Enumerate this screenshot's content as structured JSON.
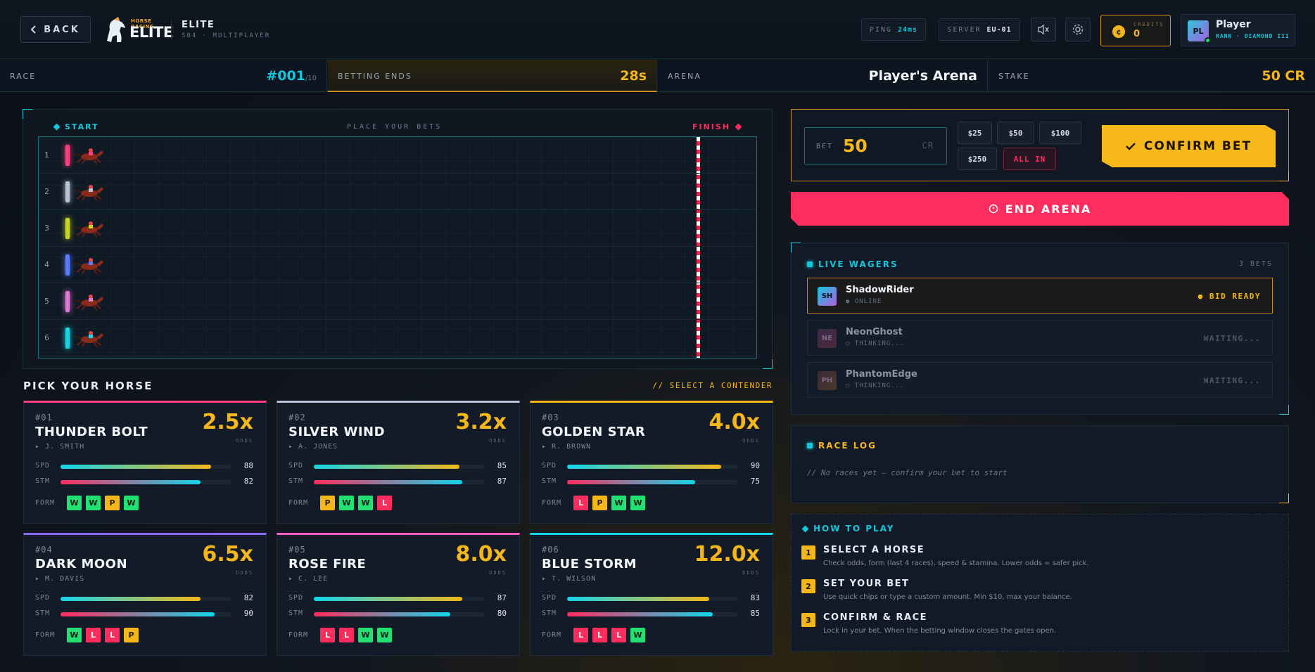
{
  "header": {
    "back_label": "BACK",
    "logo_small": "HORSE RACING",
    "logo_big": "ELITE",
    "title": "ELITE",
    "subtitle": "S04 · MULTIPLAYER",
    "ping_label": "PING",
    "ping_value": "24ms",
    "server_label": "SERVER",
    "server_value": "EU-01",
    "credits_label": "CREDITS",
    "credits_value": "0",
    "player_initials": "PL",
    "player_name": "Player",
    "player_rank": "RANK · DIAMOND III"
  },
  "strip": {
    "race_label": "RACE",
    "race_value": "#001",
    "race_total": "/10",
    "betting_label": "BETTING ENDS",
    "betting_value": "28s",
    "arena_label": "ARENA",
    "arena_value": "Player's Arena",
    "stake_label": "STAKE",
    "stake_value": "50 CR"
  },
  "race": {
    "start_label": "START",
    "center_label": "PLACE YOUR BETS",
    "finish_label": "FINISH",
    "lanes": [
      {
        "num": "1",
        "color": "#ff3d7f"
      },
      {
        "num": "2",
        "color": "#b8c4d6"
      },
      {
        "num": "3",
        "color": "#c9d61f"
      },
      {
        "num": "4",
        "color": "#5b7bff"
      },
      {
        "num": "5",
        "color": "#e07ad6"
      },
      {
        "num": "6",
        "color": "#12d6ea"
      }
    ]
  },
  "pick": {
    "title": "PICK YOUR HORSE",
    "hint": "// SELECT A CONTENDER",
    "odds_label": "ODDS",
    "spd_label": "SPD",
    "stm_label": "STM",
    "form_label": "FORM"
  },
  "horses": [
    {
      "id": "#01",
      "name": "THUNDER BOLT",
      "jockey": "▸ J. SMITH",
      "odds": "2.5x",
      "spd": 88,
      "stm": 82,
      "form": [
        "W",
        "W",
        "P",
        "W"
      ],
      "color": "#ff3d7f"
    },
    {
      "id": "#02",
      "name": "SILVER WIND",
      "jockey": "▸ A. JONES",
      "odds": "3.2x",
      "spd": 85,
      "stm": 87,
      "form": [
        "P",
        "W",
        "W",
        "L"
      ],
      "color": "#b8c4d6"
    },
    {
      "id": "#03",
      "name": "GOLDEN STAR",
      "jockey": "▸ R. BROWN",
      "odds": "4.0x",
      "spd": 90,
      "stm": 75,
      "form": [
        "L",
        "P",
        "W",
        "W"
      ],
      "color": "#f5b619"
    },
    {
      "id": "#04",
      "name": "DARK MOON",
      "jockey": "▸ M. DAVIS",
      "odds": "6.5x",
      "spd": 82,
      "stm": 90,
      "form": [
        "W",
        "L",
        "L",
        "P"
      ],
      "color": "#8b6bff"
    },
    {
      "id": "#05",
      "name": "ROSE FIRE",
      "jockey": "▸ C. LEE",
      "odds": "8.0x",
      "spd": 87,
      "stm": 80,
      "form": [
        "L",
        "L",
        "W",
        "W"
      ],
      "color": "#ff5fc0"
    },
    {
      "id": "#06",
      "name": "BLUE STORM",
      "jockey": "▸ T. WILSON",
      "odds": "12.0x",
      "spd": 83,
      "stm": 85,
      "form": [
        "L",
        "L",
        "L",
        "W"
      ],
      "color": "#12d6ea"
    }
  ],
  "bet": {
    "label": "BET",
    "value": "50",
    "unit": "CR",
    "chips": [
      "$25",
      "$50",
      "$100",
      "$250"
    ],
    "all_in": "ALL IN",
    "confirm": "CONFIRM BET",
    "end_arena": "END ARENA"
  },
  "wagers": {
    "title": "LIVE WAGERS",
    "count": "3 BETS",
    "items": [
      {
        "initials": "SH",
        "name": "ShadowRider",
        "status": "● ONLINE",
        "right": "● BID READY"
      },
      {
        "initials": "NE",
        "name": "NeonGhost",
        "status": "○ THINKING...",
        "right": "WAITING..."
      },
      {
        "initials": "PH",
        "name": "PhantomEdge",
        "status": "○ THINKING...",
        "right": "WAITING..."
      }
    ]
  },
  "log": {
    "title": "RACE LOG",
    "empty": "// No races yet — confirm your bet to start"
  },
  "how": {
    "title": "HOW TO PLAY",
    "steps": [
      {
        "n": "1",
        "title": "SELECT A HORSE",
        "desc": "Check odds, form (last 4 races), speed & stamina. Lower odds = safer pick."
      },
      {
        "n": "2",
        "title": "SET YOUR BET",
        "desc": "Use quick chips or type a custom amount. Min $10, max your balance."
      },
      {
        "n": "3",
        "title": "CONFIRM & RACE",
        "desc": "Lock in your bet. When the betting window closes the gates open."
      }
    ]
  }
}
